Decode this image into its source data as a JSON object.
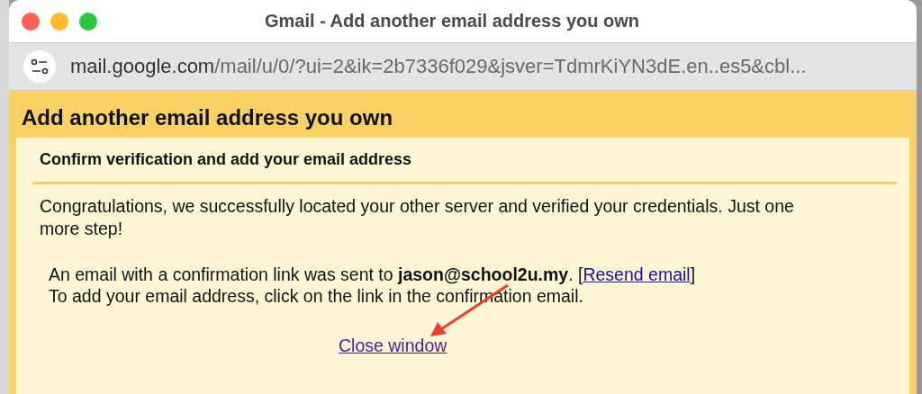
{
  "window": {
    "title": "Gmail - Add another email address you own"
  },
  "address_bar": {
    "host": "mail.google.com",
    "path": "/mail/u/0/?ui=2&ik=2b7336f029&jsver=TdmrKiYN3dE.en..es5&cbl..."
  },
  "dialog": {
    "title": "Add another email address you own",
    "heading": "Confirm verification and add your email address",
    "message": "Congratulations, we successfully located your other server and verified your credentials. Just one more step!",
    "sent_line": {
      "text": "An email with a confirmation link was sent to **jason@school2u.my**. [",
      "link": "Resend email",
      "after": "]"
    },
    "instruction": "To add your email address, click on the link in the confirmation email.",
    "close_link": "Close window"
  }
}
